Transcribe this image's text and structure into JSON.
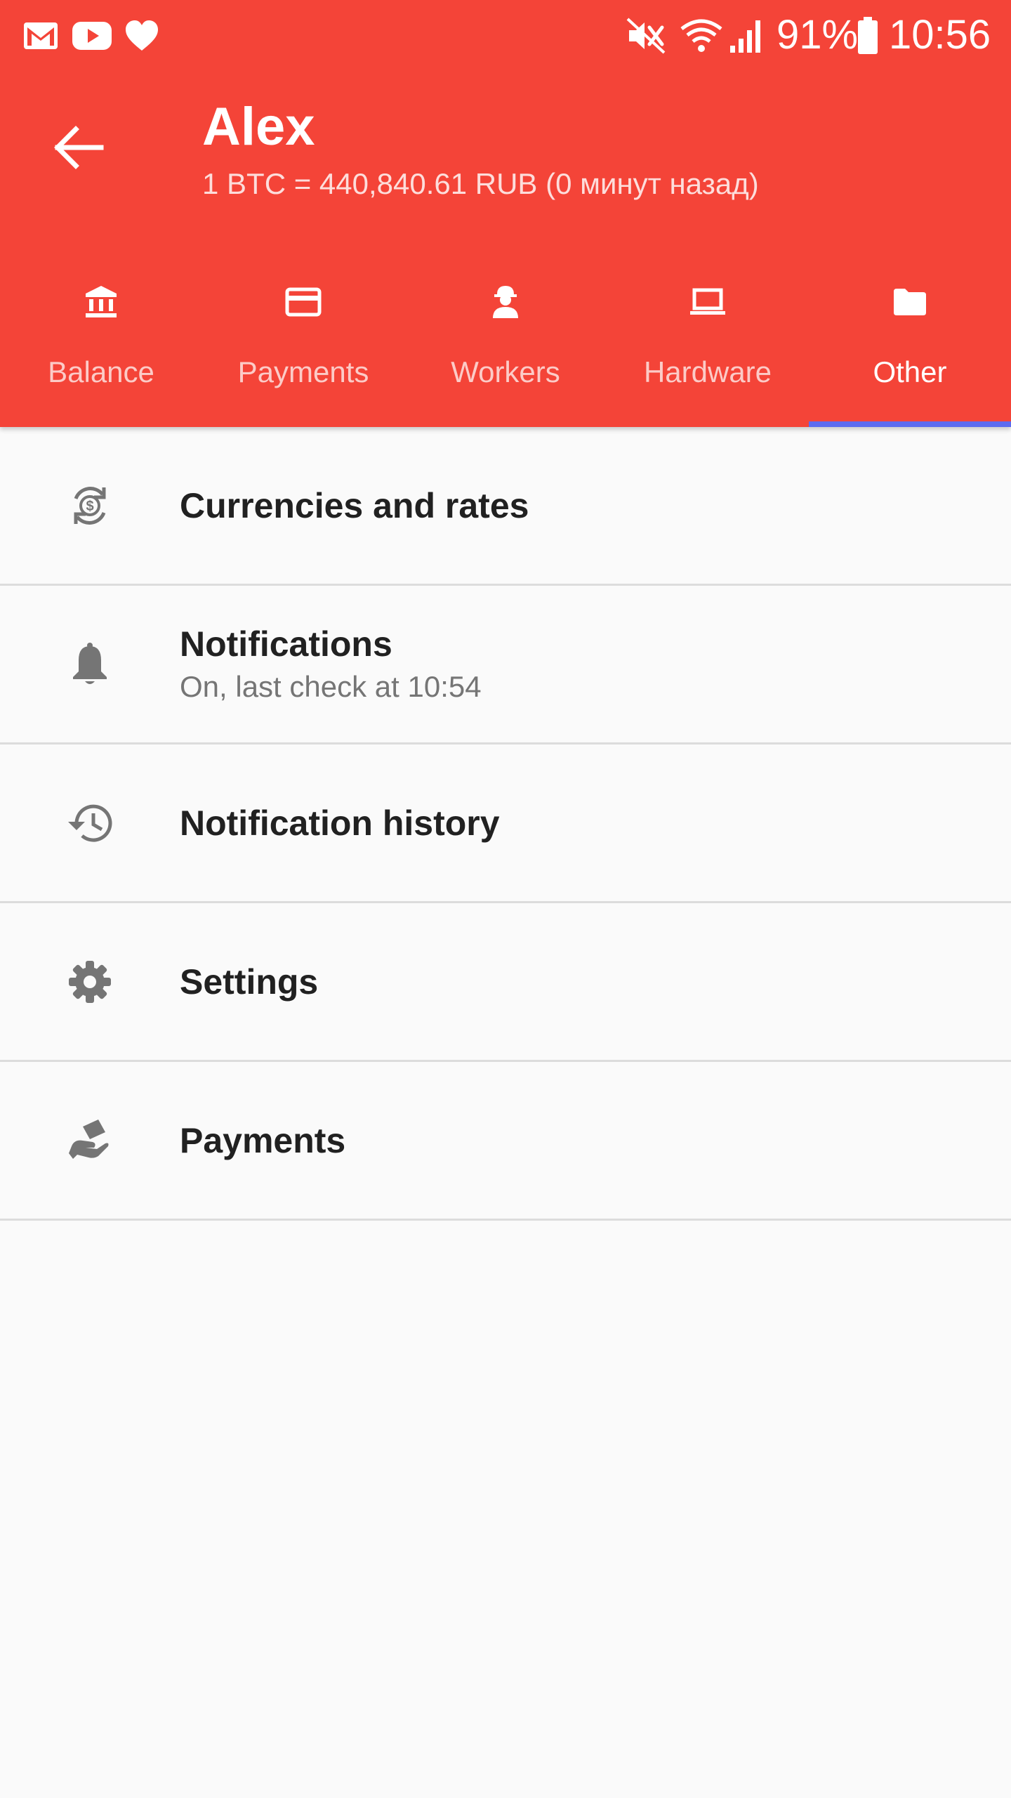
{
  "status_bar": {
    "battery": "91%",
    "time": "10:56",
    "left_icons": [
      "gmail-icon",
      "youtube-icon",
      "heart-icon"
    ],
    "right_icons": [
      "mute-icon",
      "wifi-icon",
      "signal-icon",
      "battery-icon"
    ]
  },
  "app_bar": {
    "title": "Alex",
    "subtitle": "1 BTC = 440,840.61 RUB (0 минут назад)",
    "back_icon": "arrow-back-icon"
  },
  "tabs": [
    {
      "label": "Balance",
      "icon": "bank-icon",
      "active": false
    },
    {
      "label": "Payments",
      "icon": "credit-card-icon",
      "active": false
    },
    {
      "label": "Workers",
      "icon": "worker-icon",
      "active": false
    },
    {
      "label": "Hardware",
      "icon": "laptop-icon",
      "active": false
    },
    {
      "label": "Other",
      "icon": "folder-icon",
      "active": true
    }
  ],
  "menu": [
    {
      "title": "Currencies and rates",
      "subtitle": "",
      "icon": "currency-exchange-icon"
    },
    {
      "title": "Notifications",
      "subtitle": "On, last check at 10:54",
      "icon": "bell-icon"
    },
    {
      "title": "Notification history",
      "subtitle": "",
      "icon": "history-icon"
    },
    {
      "title": "Settings",
      "subtitle": "",
      "icon": "gear-icon"
    },
    {
      "title": "Payments",
      "subtitle": "",
      "icon": "payment-hand-icon"
    }
  ],
  "colors": {
    "primary": "#f44438",
    "tab_indicator": "#5c6bf0",
    "background": "#fafafa",
    "icon_gray": "#757575",
    "divider": "#dcdcdc"
  }
}
